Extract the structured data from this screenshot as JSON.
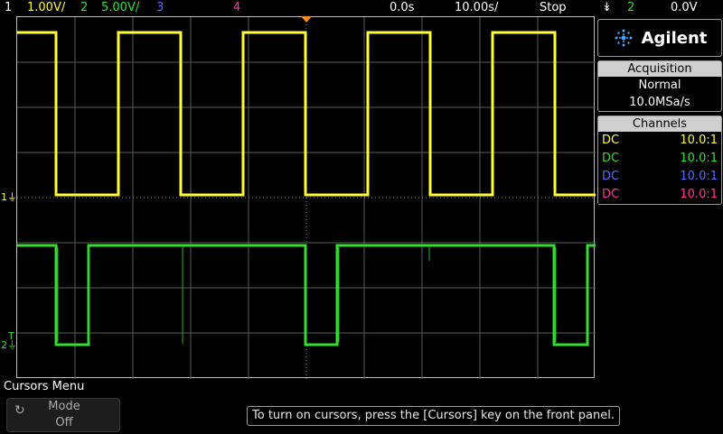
{
  "topbar": {
    "ch1_num": "1",
    "ch1_scale": "1.00V/",
    "ch2_num": "2",
    "ch2_scale": "5.00V/",
    "ch3_num": "3",
    "ch4_num": "4",
    "time_offset": "0.0s",
    "time_scale": "10.00s/",
    "run_state": "Stop",
    "trigger_symbol": "↡",
    "trigger_source": "2",
    "trigger_level": "0.0V"
  },
  "colors": {
    "ch1": "#ffff33",
    "ch2": "#33dd33",
    "ch3": "#5566ff",
    "ch4": "#ff3399",
    "trigger": "#ff8c1a"
  },
  "logo": {
    "text": "Agilent"
  },
  "acquisition": {
    "title": "Acquisition",
    "mode": "Normal",
    "rate": "10.0MSa/s"
  },
  "channels": {
    "title": "Channels",
    "rows": [
      {
        "coupling": "DC",
        "probe": "10.0:1"
      },
      {
        "coupling": "DC",
        "probe": "10.0:1"
      },
      {
        "coupling": "DC",
        "probe": "10.0:1"
      },
      {
        "coupling": "DC",
        "probe": "10.0:1"
      }
    ]
  },
  "markers": {
    "ch1_label": "1",
    "ch2_label": "2",
    "trigger_t": "T"
  },
  "bottom": {
    "menu_title": "Cursors Menu",
    "softkey_label": "Mode",
    "softkey_value": "Off",
    "message": "To turn on cursors, press the [Cursors] key on the front panel."
  }
}
